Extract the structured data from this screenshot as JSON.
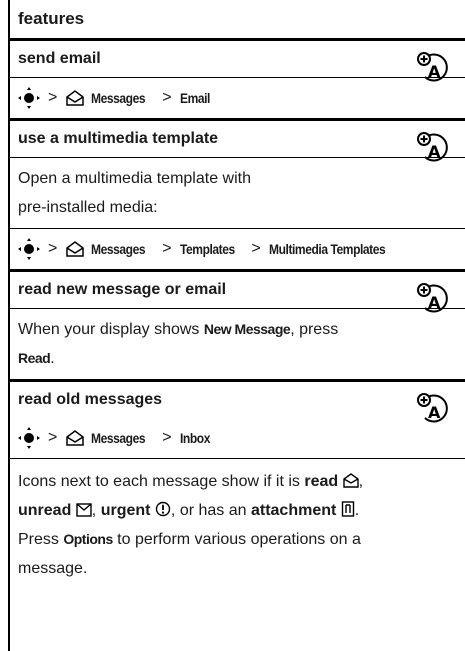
{
  "header": {
    "title": "features"
  },
  "sections": {
    "send_email": {
      "title": "send email",
      "nav": {
        "sep": ">",
        "messages": "Messages",
        "item": "Email"
      }
    },
    "template": {
      "title": "use a multimedia template",
      "text_line1": "Open a multimedia template with",
      "text_line2": "pre-installed media:",
      "nav": {
        "sep": ">",
        "messages": "Messages",
        "templates": "Templates",
        "item": "Multimedia Templates"
      }
    },
    "read_new": {
      "title": "read new message or email",
      "text_before": "When your display shows ",
      "kw_new_message": "New Message",
      "text_mid": ", press",
      "kw_read": "Read",
      "text_end": "."
    },
    "read_old": {
      "title": "read old messages",
      "nav": {
        "sep": ">",
        "messages": "Messages",
        "item": "Inbox"
      },
      "p1": {
        "t1": "Icons next to each message show if it is ",
        "read": "read",
        "t2": ", ",
        "unread": "unread",
        "t3": ", ",
        "urgent": "urgent",
        "t4": ", or has an ",
        "attachment": "attachment",
        "t5": "."
      },
      "p2": {
        "t1": "Press ",
        "options": "Options",
        "t2": " to perform various operations on a",
        "t3": "message."
      }
    }
  },
  "icons": {
    "feature": "network-feature-icon",
    "nav_key": "nav-key-icon",
    "messages": "envelope-icon",
    "read": "open-envelope-icon",
    "unread": "closed-envelope-icon",
    "urgent": "urgent-icon",
    "attachment": "attachment-icon"
  }
}
